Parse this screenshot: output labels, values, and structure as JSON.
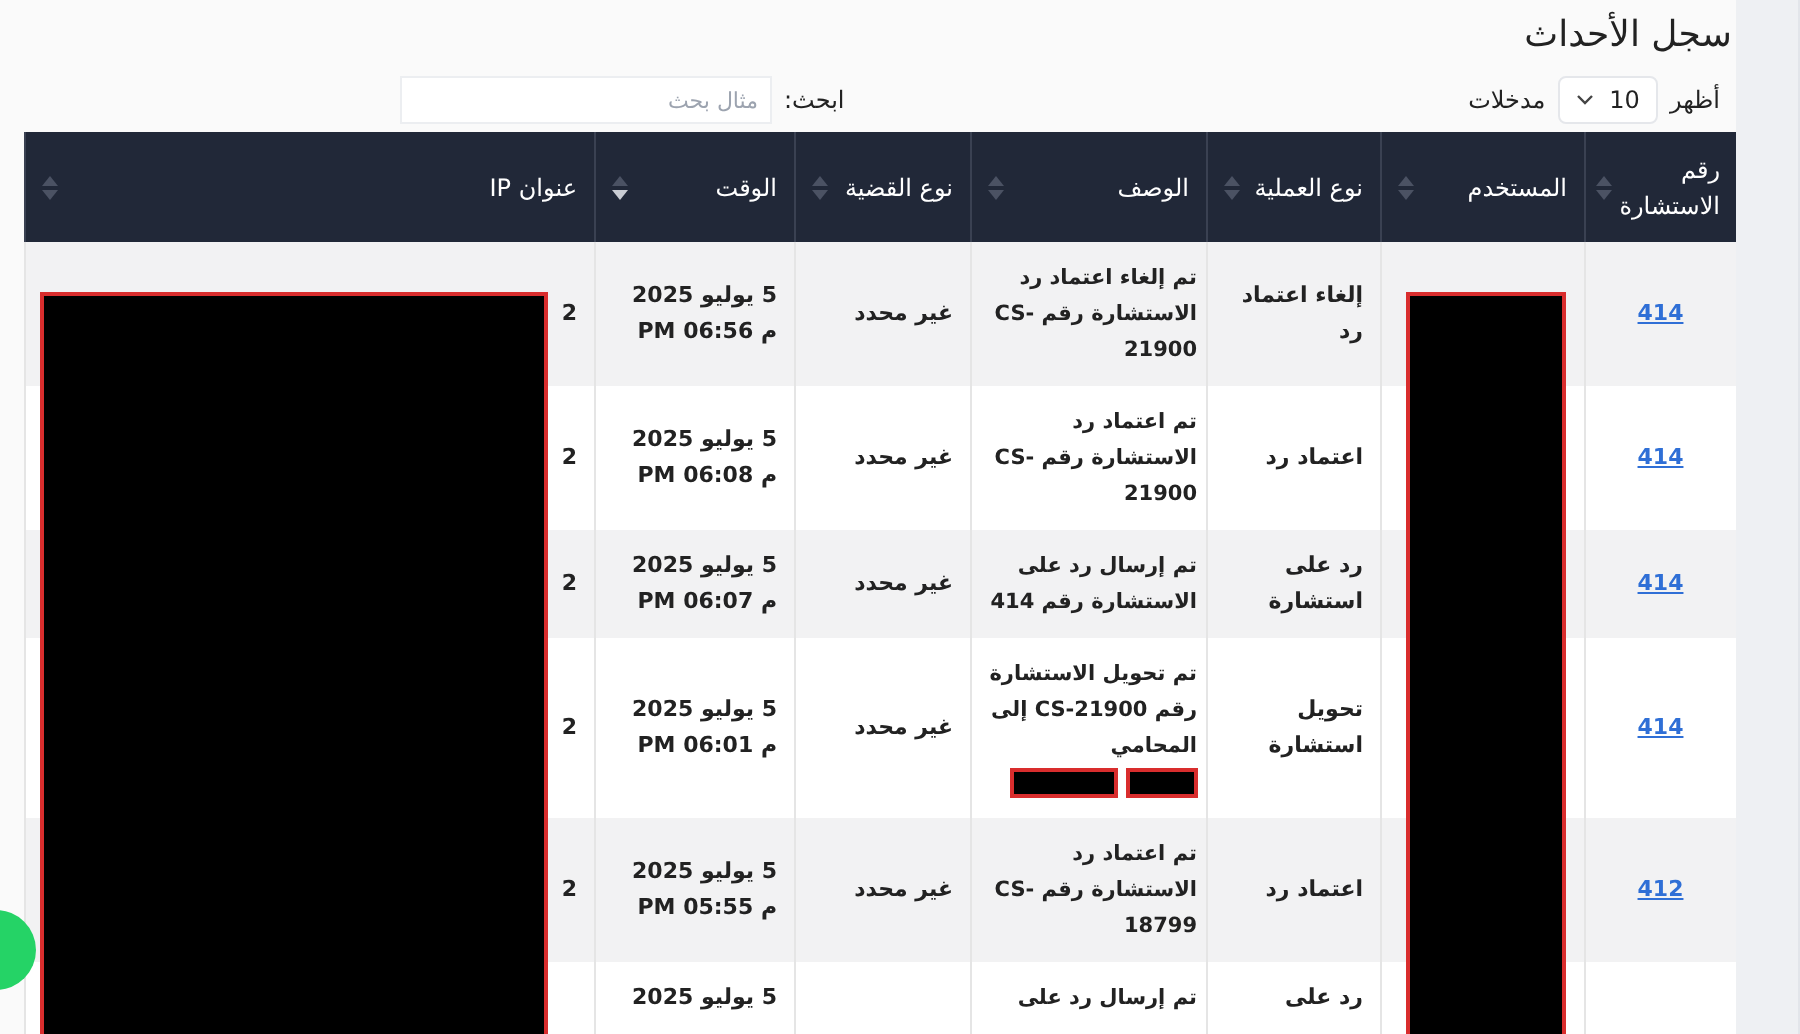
{
  "title": "سجل الأحداث",
  "length_control": {
    "before": "أظهر",
    "value": "10",
    "after": "مدخلات"
  },
  "search": {
    "label": "ابحث:",
    "placeholder": "مثال بحث"
  },
  "table": {
    "columns": [
      {
        "label": "رقم الاستشارة",
        "sorted": false
      },
      {
        "label": "المستخدم",
        "sorted": false
      },
      {
        "label": "نوع العملية",
        "sorted": false
      },
      {
        "label": "الوصف",
        "sorted": false
      },
      {
        "label": "نوع القضية",
        "sorted": false
      },
      {
        "label": "الوقت",
        "sorted": true
      },
      {
        "label": "عنوان IP",
        "sorted": false
      }
    ],
    "rows": [
      {
        "id": "414",
        "operation": "إلغاء اعتماد رد",
        "description": "تم إلغاء اعتماد رد الاستشارة رقم CS-21900",
        "redacted": false,
        "case_type": "غير محدد",
        "date": "5 يوليو 2025",
        "clock": "PM 06:56 م",
        "ip": "2"
      },
      {
        "id": "414",
        "operation": "اعتماد رد",
        "description": "تم اعتماد رد الاستشارة رقم CS-21900",
        "redacted": false,
        "case_type": "غير محدد",
        "date": "5 يوليو 2025",
        "clock": "PM 06:08 م",
        "ip": "2"
      },
      {
        "id": "414",
        "operation": "رد على استشارة",
        "description": "تم إرسال رد على الاستشارة رقم 414",
        "redacted": false,
        "case_type": "غير محدد",
        "date": "5 يوليو 2025",
        "clock": "PM 06:07 م",
        "ip": "2"
      },
      {
        "id": "414",
        "operation": "تحويل استشارة",
        "description": "تم تحويل الاستشارة رقم CS-21900 إلى المحامي",
        "redacted": true,
        "case_type": "غير محدد",
        "date": "5 يوليو 2025",
        "clock": "PM 06:01 م",
        "ip": "2"
      },
      {
        "id": "412",
        "operation": "اعتماد رد",
        "description": "تم اعتماد رد الاستشارة رقم CS-18799",
        "redacted": false,
        "case_type": "غير محدد",
        "date": "5 يوليو 2025",
        "clock": "PM 05:55 م",
        "ip": "2"
      },
      {
        "operation": "رد على",
        "description": "تم إرسال رد على",
        "redacted": false,
        "date": "5 يوليو 2025"
      }
    ]
  }
}
